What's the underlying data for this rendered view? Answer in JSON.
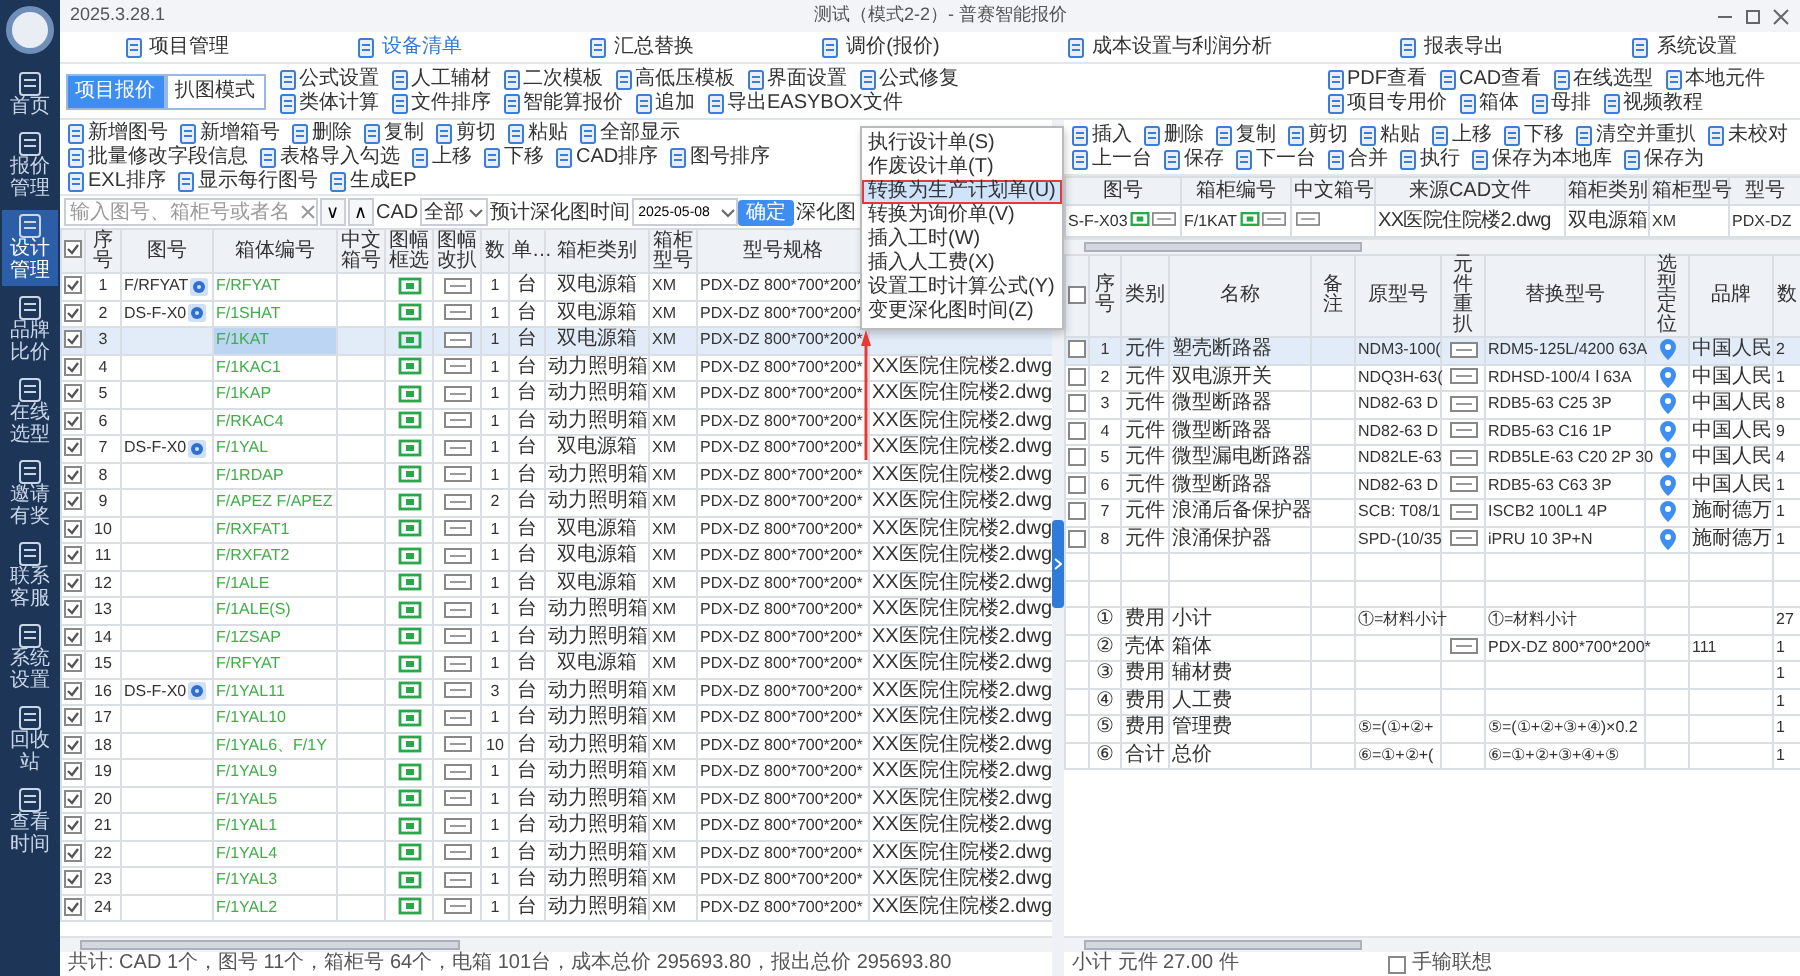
{
  "app": {
    "version": "2025.3.28.1",
    "title": "测试（模式2-2）- 普赛智能报价"
  },
  "sidebar": [
    {
      "label": "首页",
      "selected": false
    },
    {
      "label": "报价管理",
      "selected": false
    },
    {
      "label": "设计管理",
      "selected": true
    },
    {
      "label": "品牌比价",
      "selected": false
    },
    {
      "label": "在线选型",
      "selected": false
    },
    {
      "label": "邀请有奖",
      "selected": false
    },
    {
      "label": "联系客服",
      "selected": false
    },
    {
      "label": "系统设置",
      "selected": false
    },
    {
      "label": "回收站",
      "selected": false
    },
    {
      "label": "查看时间",
      "selected": false
    }
  ],
  "nav": [
    {
      "label": "项目管理",
      "selected": false
    },
    {
      "label": "设备清单",
      "selected": true
    },
    {
      "label": "汇总替换",
      "selected": false
    },
    {
      "label": "调价(报价)",
      "selected": false
    },
    {
      "label": "成本设置与利润分析",
      "selected": false
    },
    {
      "label": "报表导出",
      "selected": false
    },
    {
      "label": "系统设置",
      "selected": false
    }
  ],
  "modes": [
    {
      "label": "项目报价",
      "selected": true
    },
    {
      "label": "扒图模式",
      "selected": false
    }
  ],
  "tools": [
    "公式设置",
    "人工辅材",
    "二次模板",
    "高低压模板",
    "界面设置",
    "公式修复",
    "类体计算",
    "文件排序",
    "智能算报价",
    "追加",
    "导出EASYBOX文件"
  ],
  "quick_links": [
    "PDF查看",
    "CAD查看",
    "在线选型",
    "本地元件",
    "项目专用价",
    "箱体",
    "母排",
    "视频教程"
  ],
  "left_toolbar": [
    "新增图号",
    "新增箱号",
    "删除",
    "复制",
    "剪切",
    "粘贴",
    "全部显示",
    "批量修改字段信息",
    "表格导入勾选",
    "上移",
    "下移",
    "CAD排序",
    "图号排序",
    "EXL排序",
    "显示每行图号",
    "生成EP"
  ],
  "filter": {
    "placeholder": "输入图号、箱柜号或者名",
    "down": "∨",
    "up": "∧",
    "cad_label": "CAD",
    "cad_value": "全部",
    "date_label": "预计深化图时间",
    "date_value": "2025-05-08",
    "confirm": "确定",
    "next_label": "深化图"
  },
  "left_table": {
    "all_checked": true,
    "columns": [
      "序号",
      "图号",
      "箱体编号",
      "中文箱号",
      "图幅框选",
      "图幅改扒",
      "数",
      "单…",
      "箱柜类别",
      "箱柜型号",
      "型号规格"
    ],
    "rows": [
      {
        "no": "1",
        "checked": true,
        "selected": false,
        "drawing": "F/RFYAT",
        "gear": true,
        "box": "F/RFYAT",
        "qty": "1",
        "unit": "台",
        "category": "双电源箱",
        "model": "XM",
        "spec": "PDX-DZ 800*700*200*"
      },
      {
        "no": "2",
        "checked": true,
        "selected": false,
        "drawing": "DS-F-X0",
        "gear": true,
        "box": "F/1SHAT",
        "qty": "1",
        "unit": "台",
        "category": "双电源箱",
        "model": "XM",
        "spec": "PDX-DZ 800*700*200*"
      },
      {
        "no": "3",
        "checked": true,
        "selected": true,
        "gear": false,
        "box": "F/1KAT",
        "qty": "1",
        "unit": "台",
        "category": "双电源箱",
        "model": "XM",
        "spec": "PDX-DZ 800*700*200*"
      },
      {
        "no": "4",
        "checked": true,
        "selected": false,
        "gear": false,
        "box": "F/1KAC1",
        "qty": "1",
        "unit": "台",
        "category": "动力照明箱",
        "model": "XM",
        "spec": "PDX-DZ 800*700*200*",
        "cad": "XX医院住院楼2.dwg"
      },
      {
        "no": "5",
        "checked": true,
        "selected": false,
        "gear": false,
        "box": "F/1KAP",
        "qty": "1",
        "unit": "台",
        "category": "动力照明箱",
        "model": "XM",
        "spec": "PDX-DZ 800*700*200*",
        "cad": "XX医院住院楼2.dwg"
      },
      {
        "no": "6",
        "checked": true,
        "selected": false,
        "gear": false,
        "box": "F/RKAC4",
        "qty": "1",
        "unit": "台",
        "category": "动力照明箱",
        "model": "XM",
        "spec": "PDX-DZ 800*700*200*",
        "cad": "XX医院住院楼2.dwg"
      },
      {
        "no": "7",
        "checked": true,
        "selected": false,
        "drawing": "DS-F-X0",
        "gear": true,
        "box": "F/1YAL",
        "qty": "1",
        "unit": "台",
        "category": "双电源箱",
        "model": "XM",
        "spec": "PDX-DZ 800*700*200*",
        "cad": "XX医院住院楼2.dwg"
      },
      {
        "no": "8",
        "checked": true,
        "selected": false,
        "gear": false,
        "box": "F/1RDAP",
        "qty": "1",
        "unit": "台",
        "category": "动力照明箱",
        "model": "XM",
        "spec": "PDX-DZ 800*700*200*",
        "cad": "XX医院住院楼2.dwg"
      },
      {
        "no": "9",
        "checked": true,
        "selected": false,
        "gear": false,
        "box": "F/APEZ F/APEZ",
        "qty": "2",
        "unit": "台",
        "category": "动力照明箱",
        "model": "XM",
        "spec": "PDX-DZ 800*700*200*",
        "cad": "XX医院住院楼2.dwg"
      },
      {
        "no": "10",
        "checked": true,
        "selected": false,
        "gear": false,
        "box": "F/RXFAT1",
        "qty": "1",
        "unit": "台",
        "category": "双电源箱",
        "model": "XM",
        "spec": "PDX-DZ 800*700*200*",
        "cad": "XX医院住院楼2.dwg"
      },
      {
        "no": "11",
        "checked": true,
        "selected": false,
        "gear": false,
        "box": "F/RXFAT2",
        "qty": "1",
        "unit": "台",
        "category": "双电源箱",
        "model": "XM",
        "spec": "PDX-DZ 800*700*200*",
        "cad": "XX医院住院楼2.dwg"
      },
      {
        "no": "12",
        "checked": true,
        "selected": false,
        "gear": false,
        "box": "F/1ALE",
        "qty": "1",
        "unit": "台",
        "category": "双电源箱",
        "model": "XM",
        "spec": "PDX-DZ 800*700*200*",
        "cad": "XX医院住院楼2.dwg"
      },
      {
        "no": "13",
        "checked": true,
        "selected": false,
        "gear": false,
        "box": "F/1ALE(S)",
        "qty": "1",
        "unit": "台",
        "category": "动力照明箱",
        "model": "XM",
        "spec": "PDX-DZ 800*700*200*",
        "cad": "XX医院住院楼2.dwg"
      },
      {
        "no": "14",
        "checked": true,
        "selected": false,
        "gear": false,
        "box": "F/1ZSAP",
        "qty": "1",
        "unit": "台",
        "category": "动力照明箱",
        "model": "XM",
        "spec": "PDX-DZ 800*700*200*",
        "cad": "XX医院住院楼2.dwg"
      },
      {
        "no": "15",
        "checked": true,
        "selected": false,
        "gear": false,
        "box": "F/RFYAT",
        "qty": "1",
        "unit": "台",
        "category": "双电源箱",
        "model": "XM",
        "spec": "PDX-DZ 800*700*200*",
        "cad": "XX医院住院楼2.dwg"
      },
      {
        "no": "16",
        "checked": true,
        "selected": false,
        "drawing": "DS-F-X0",
        "gear": true,
        "box": "F/1YAL11",
        "qty": "3",
        "unit": "台",
        "category": "动力照明箱",
        "model": "XM",
        "spec": "PDX-DZ 800*700*200*",
        "cad": "XX医院住院楼2.dwg"
      },
      {
        "no": "17",
        "checked": true,
        "selected": false,
        "gear": false,
        "box": "F/1YAL10",
        "qty": "1",
        "unit": "台",
        "category": "动力照明箱",
        "model": "XM",
        "spec": "PDX-DZ 800*700*200*",
        "cad": "XX医院住院楼2.dwg"
      },
      {
        "no": "18",
        "checked": true,
        "selected": false,
        "gear": false,
        "box": "F/1YAL6、F/1Y",
        "qty": "10",
        "unit": "台",
        "category": "动力照明箱",
        "model": "XM",
        "spec": "PDX-DZ 800*700*200*",
        "cad": "XX医院住院楼2.dwg"
      },
      {
        "no": "19",
        "checked": true,
        "selected": false,
        "gear": false,
        "box": "F/1YAL9",
        "qty": "1",
        "unit": "台",
        "category": "动力照明箱",
        "model": "XM",
        "spec": "PDX-DZ 800*700*200*",
        "cad": "XX医院住院楼2.dwg"
      },
      {
        "no": "20",
        "checked": true,
        "selected": false,
        "gear": false,
        "box": "F/1YAL5",
        "qty": "1",
        "unit": "台",
        "category": "动力照明箱",
        "model": "XM",
        "spec": "PDX-DZ 800*700*200*",
        "cad": "XX医院住院楼2.dwg"
      },
      {
        "no": "21",
        "checked": true,
        "selected": false,
        "gear": false,
        "box": "F/1YAL1",
        "qty": "1",
        "unit": "台",
        "category": "动力照明箱",
        "model": "XM",
        "spec": "PDX-DZ 800*700*200*",
        "cad": "XX医院住院楼2.dwg"
      },
      {
        "no": "22",
        "checked": true,
        "selected": false,
        "gear": false,
        "box": "F/1YAL4",
        "qty": "1",
        "unit": "台",
        "category": "动力照明箱",
        "model": "XM",
        "spec": "PDX-DZ 800*700*200*",
        "cad": "XX医院住院楼2.dwg"
      },
      {
        "no": "23",
        "checked": true,
        "selected": false,
        "gear": false,
        "box": "F/1YAL3",
        "qty": "1",
        "unit": "台",
        "category": "动力照明箱",
        "model": "XM",
        "spec": "PDX-DZ 800*700*200*",
        "cad": "XX医院住院楼2.dwg"
      },
      {
        "no": "24",
        "checked": true,
        "selected": false,
        "gear": false,
        "box": "F/1YAL2",
        "qty": "1",
        "unit": "台",
        "category": "动力照明箱",
        "model": "XM",
        "spec": "PDX-DZ 800*700*200*",
        "cad": "XX医院住院楼2.dwg"
      }
    ]
  },
  "left_status": "共计: CAD 1个，图号 11个，箱柜号 64个，电箱 101台，成本总价 295693.80，报出总价 295693.80",
  "context_menu": [
    {
      "label": "执行设计单(S)",
      "selected": false
    },
    {
      "label": "作废设计单(T)",
      "selected": false
    },
    {
      "label": "转换为生产计划单(U)",
      "selected": true
    },
    {
      "label": "转换为询价单(V)",
      "selected": false
    },
    {
      "label": "插入工时(W)",
      "selected": false
    },
    {
      "label": "插入人工费(X)",
      "selected": false
    },
    {
      "label": "设置工时计算公式(Y)",
      "selected": false
    },
    {
      "label": "变更深化图时间(Z)",
      "selected": false
    }
  ],
  "right_toolbar": [
    "插入",
    "删除",
    "复制",
    "剪切",
    "粘贴",
    "上移",
    "下移",
    "清空并重扒",
    "未校对",
    "上一台",
    "保存",
    "下一台",
    "合并",
    "执行",
    "保存为本地库",
    "保存为"
  ],
  "box_header": {
    "columns": [
      "图号",
      "箱柜编号",
      "中文箱号",
      "来源CAD文件",
      "箱柜类别",
      "箱柜型号",
      "型号"
    ],
    "cells": [
      {
        "text": "S-F-X03",
        "frame": true,
        "tag": true
      },
      {
        "text": "F/1KAT",
        "frame": true,
        "tag": true
      },
      {
        "frame": false,
        "tag": true
      },
      {
        "text": "XX医院住院楼2.dwg",
        "frame": false,
        "tag": false
      },
      {
        "text": "双电源箱",
        "frame": false,
        "tag": false
      },
      {
        "text": "XM",
        "frame": false,
        "tag": false
      },
      {
        "text": "PDX-DZ",
        "frame": false,
        "tag": false
      }
    ]
  },
  "parts": {
    "all_checked": false,
    "columns": [
      "序号",
      "类别",
      "名称",
      "备注",
      "原型号",
      "元件重扒",
      "替换型号",
      "选型定位",
      "品牌",
      "数"
    ],
    "rows": [
      {
        "kind": "component",
        "checked": false,
        "selected": true,
        "no": "1",
        "category": "元件",
        "name": "塑壳断路器",
        "original": "NDM3-100(",
        "replacement": "RDM5-125L/4200 63A",
        "brand": "中国人民",
        "qty": "2"
      },
      {
        "kind": "component",
        "checked": false,
        "selected": false,
        "no": "2",
        "category": "元件",
        "name": "双电源开关",
        "original": "NDQ3H-63(",
        "replacement": "RDHSD-100/4 Ⅰ 63A",
        "brand": "中国人民",
        "qty": "1"
      },
      {
        "kind": "component",
        "checked": false,
        "selected": false,
        "no": "3",
        "category": "元件",
        "name": "微型断路器",
        "original": "ND82-63 D",
        "replacement": "RDB5-63 C25 3P",
        "brand": "中国人民",
        "qty": "8"
      },
      {
        "kind": "component",
        "checked": false,
        "selected": false,
        "no": "4",
        "category": "元件",
        "name": "微型断路器",
        "original": "ND82-63 D",
        "replacement": "RDB5-63 C16 1P",
        "brand": "中国人民",
        "qty": "9"
      },
      {
        "kind": "component",
        "checked": false,
        "selected": false,
        "no": "5",
        "category": "元件",
        "name": "微型漏电断路器",
        "original": "ND82LE-63",
        "replacement": "RDB5LE-63 C20 2P 30",
        "brand": "中国人民",
        "qty": "4"
      },
      {
        "kind": "component",
        "checked": false,
        "selected": false,
        "no": "6",
        "category": "元件",
        "name": "微型断路器",
        "original": "ND82-63 D",
        "replacement": "RDB5-63 C63 3P",
        "brand": "中国人民",
        "qty": "1"
      },
      {
        "kind": "component",
        "checked": false,
        "selected": false,
        "no": "7",
        "category": "元件",
        "name": "浪涌后备保护器",
        "original": "SCB: T08/1",
        "replacement": "ISCB2 100L1 4P",
        "brand": "施耐德万",
        "qty": "1"
      },
      {
        "kind": "component",
        "checked": false,
        "selected": false,
        "no": "8",
        "category": "元件",
        "name": "浪涌保护器",
        "original": "SPD-(10/35",
        "replacement": "iPRU 10 3P+N",
        "brand": "施耐德万",
        "qty": "1"
      },
      {
        "kind": "summary",
        "selected": false,
        "reparse": false,
        "no": "①",
        "category": "费用",
        "name": "小计",
        "original": "①=材料小计",
        "replacement": "①=材料小计",
        "qty": "27"
      },
      {
        "kind": "summary",
        "selected": false,
        "reparse": true,
        "no": "②",
        "category": "壳体",
        "name": "箱体",
        "replacement": "PDX-DZ 800*700*200*",
        "brand": "111",
        "qty": "1"
      },
      {
        "kind": "summary",
        "selected": false,
        "reparse": false,
        "no": "③",
        "category": "费用",
        "name": "辅材费",
        "qty": "1"
      },
      {
        "kind": "summary",
        "selected": false,
        "reparse": false,
        "no": "④",
        "category": "费用",
        "name": "人工费",
        "qty": "1"
      },
      {
        "kind": "summary",
        "selected": false,
        "reparse": false,
        "no": "⑤",
        "category": "费用",
        "name": "管理费",
        "original": "⑤=(①+②+",
        "replacement": "⑤=(①+②+③+④)×0.2",
        "qty": "1"
      },
      {
        "kind": "summary",
        "selected": false,
        "reparse": false,
        "no": "⑥",
        "category": "合计",
        "name": "总价",
        "original": "⑥=①+②+(",
        "replacement": "⑥=①+②+③+④+⑤",
        "qty": "1"
      }
    ]
  },
  "right_footer": {
    "subtotal": "小计 元件 27.00 件",
    "manual_label": "手输联想",
    "manual_checked": false
  }
}
